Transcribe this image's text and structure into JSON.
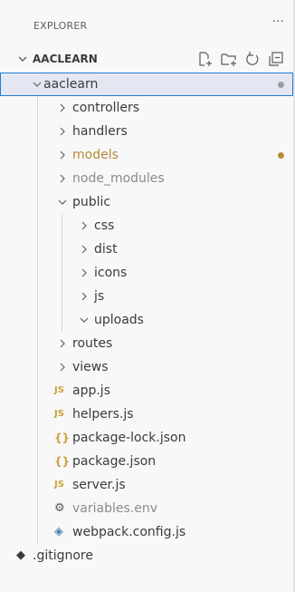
{
  "title": "EXPLORER",
  "section": {
    "title": "AACLEARN"
  },
  "colors": {
    "modified": "#b78a3c",
    "muted": "#8a8a8a",
    "js": "#c7a33a",
    "json": "#c7a33a",
    "dot_grey": "#9c9c9c"
  },
  "icons": {
    "more": "more-icon",
    "new_file": "new-file-icon",
    "new_folder": "new-folder-icon",
    "refresh": "refresh-icon",
    "collapse": "collapse-all-icon"
  },
  "tree": [
    {
      "label": "aaclearn",
      "type": "folder-open",
      "depth": 0,
      "selected": true,
      "badge": "dot-grey"
    },
    {
      "label": "controllers",
      "type": "folder",
      "depth": 1
    },
    {
      "label": "handlers",
      "type": "folder",
      "depth": 1
    },
    {
      "label": "models",
      "type": "folder",
      "depth": 1,
      "modified": true,
      "badge": "dot-modified"
    },
    {
      "label": "node_modules",
      "type": "folder",
      "depth": 1,
      "muted": true
    },
    {
      "label": "public",
      "type": "folder-open",
      "depth": 1
    },
    {
      "label": "css",
      "type": "folder",
      "depth": 2
    },
    {
      "label": "dist",
      "type": "folder",
      "depth": 2
    },
    {
      "label": "icons",
      "type": "folder",
      "depth": 2
    },
    {
      "label": "js",
      "type": "folder",
      "depth": 2
    },
    {
      "label": "uploads",
      "type": "folder-open",
      "depth": 2
    },
    {
      "label": "routes",
      "type": "folder",
      "depth": 1
    },
    {
      "label": "views",
      "type": "folder",
      "depth": 1
    },
    {
      "label": "app.js",
      "type": "js",
      "depth": 1
    },
    {
      "label": "helpers.js",
      "type": "js",
      "depth": 1
    },
    {
      "label": "package-lock.json",
      "type": "json",
      "depth": 1
    },
    {
      "label": "package.json",
      "type": "json",
      "depth": 1
    },
    {
      "label": "server.js",
      "type": "js",
      "depth": 1
    },
    {
      "label": "variables.env",
      "type": "env",
      "depth": 1,
      "muted": true
    },
    {
      "label": "webpack.config.js",
      "type": "webpack",
      "depth": 1
    },
    {
      "label": ".gitignore",
      "type": "git",
      "depth": 0
    }
  ]
}
